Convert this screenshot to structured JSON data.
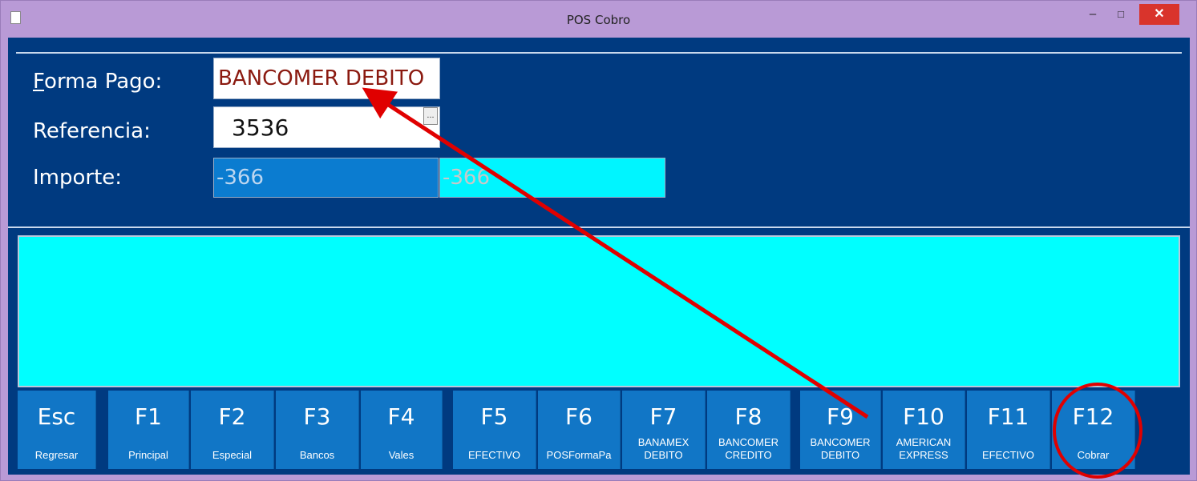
{
  "window": {
    "title": "POS Cobro",
    "minimize": "–",
    "maximize": "□",
    "close": "✕"
  },
  "form": {
    "forma_pago_label": "Forma Pago:",
    "forma_pago_mnemonic": "F",
    "forma_pago_rest": "orma Pago:",
    "forma_pago_value": "BANCOMER DEBITO",
    "referencia_label": "Referencia:",
    "referencia_value": "3536",
    "referencia_button": "...",
    "importe_label": "Importe:",
    "importe_value": "-366",
    "importe_value_2": "-366"
  },
  "function_keys": [
    {
      "key": "Esc",
      "label": "Regresar"
    },
    {
      "key": "F1",
      "label": "Principal"
    },
    {
      "key": "F2",
      "label": "Especial"
    },
    {
      "key": "F3",
      "label": "Bancos"
    },
    {
      "key": "F4",
      "label": "Vales"
    },
    {
      "key": "F5",
      "label": "EFECTIVO"
    },
    {
      "key": "F6",
      "label": "POSFormaPa"
    },
    {
      "key": "F7",
      "label": "BANAMEX\nDEBITO"
    },
    {
      "key": "F8",
      "label": "BANCOMER\nCREDITO"
    },
    {
      "key": "F9",
      "label": "BANCOMER\nDEBITO"
    },
    {
      "key": "F10",
      "label": "AMERICAN\nEXPRESS"
    },
    {
      "key": "F11",
      "label": "EFECTIVO"
    },
    {
      "key": "F12",
      "label": "Cobrar"
    }
  ],
  "colors": {
    "client_bg": "#003a80",
    "key_bg": "#1176c6",
    "panel": "#00ffff",
    "annotation": "#e00000"
  }
}
